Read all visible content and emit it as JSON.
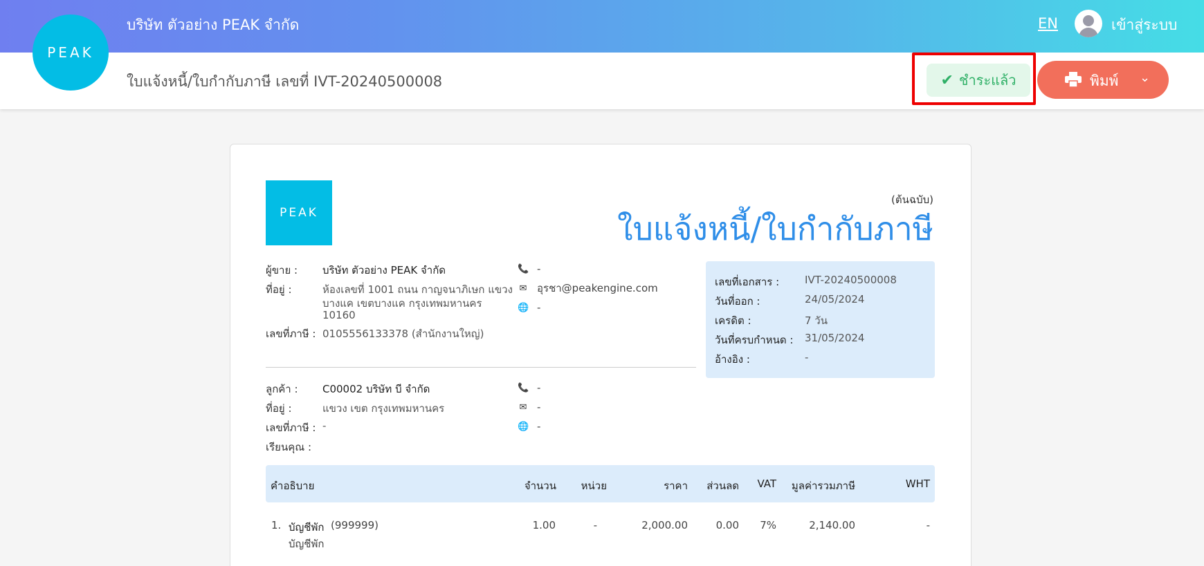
{
  "header": {
    "company_name": "บริษัท ตัวอย่าง PEAK จำกัด",
    "lang": "EN",
    "login": "เข้าสู่ระบบ",
    "logo_text": "PEAK"
  },
  "subheader": {
    "doc_title": "ใบแจ้งหนี้/ใบกำกับภาษี เลขที่  IVT-20240500008",
    "paid_label": "ชำระแล้ว",
    "print_label": "พิมพ์"
  },
  "document": {
    "logo_text": "PEAK",
    "copy_label": "(ต้นฉบับ)",
    "title": "ใบแจ้งหนี้/ใบกำกับภาษี",
    "seller": {
      "name_label": "ผู้ขาย :",
      "name": "บริษัท ตัวอย่าง PEAK จำกัด",
      "address_label": "ที่อยู่ :",
      "address_line1": "ห้องเลขที่ 1001 ถนน กาญจนาภิเษก แขวง",
      "address_line2": "บางแค เขตบางแค กรุงเทพมหานคร",
      "address_line3": "10160",
      "tax_label": "เลขที่ภาษี :",
      "tax_id": "0105556133378 (สำนักงานใหญ่)",
      "phone": "-",
      "email": "อุรชา@peakengine.com",
      "web": "-"
    },
    "customer": {
      "name_label": "ลูกค้า :",
      "name": "C00002 บริษัท บี จำกัด",
      "address_label": "ที่อยู่ :",
      "address": " แขวง เขต กรุงเทพมหานคร",
      "tax_label": "เลขที่ภาษี :",
      "tax_id": "-",
      "attn_label": "เรียนคุณ :",
      "phone": "-",
      "email": "-",
      "web": "-"
    },
    "info": {
      "doc_no_label": "เลขที่เอกสาร :",
      "doc_no": "IVT-20240500008",
      "issue_label": "วันที่ออก :",
      "issue_date": "24/05/2024",
      "credit_label": "เครดิต :",
      "credit": "7 วัน",
      "due_label": "วันที่ครบกำหนด :",
      "due_date": "31/05/2024",
      "ref_label": "อ้างอิง :",
      "ref": "-"
    },
    "table": {
      "headers": {
        "desc": "คำอธิบาย",
        "qty": "จำนวน",
        "unit": "หน่วย",
        "price": "ราคา",
        "discount": "ส่วนลด",
        "vat": "VAT",
        "total": "มูลค่ารวมภาษี",
        "wht": "WHT"
      },
      "rows": [
        {
          "no": "1.",
          "name": "บัญชีพัก",
          "code": "(999999)",
          "sub": "บัญชีพัก",
          "qty": "1.00",
          "unit": "-",
          "price": "2,000.00",
          "discount": "0.00",
          "vat": "7%",
          "total": "2,140.00",
          "wht": "-"
        }
      ]
    }
  }
}
